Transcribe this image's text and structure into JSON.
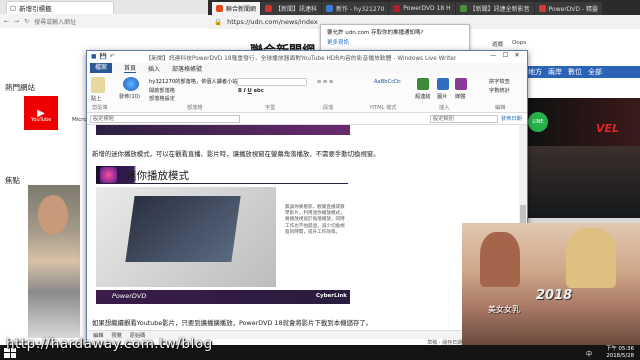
{
  "edge": {
    "tab_title": "新增引標籤",
    "search_placeholder": "搜尋或輸入網址",
    "hot_sites_title": "熱門網站",
    "youtube_label": "YouTube",
    "micro_label": "Micro",
    "focus_title": "焦點"
  },
  "udn": {
    "tabs": [
      "聯合新聞網",
      "【新聞】訊連科",
      "新作 - hy321270",
      "PowerDVD 18 H",
      "【新聞】訊連全新影音",
      "PowerDVD - 精靈"
    ],
    "url": "https://udn.com/news/index",
    "logo": "聯合新聞網",
    "push_title": "要允許 udn.com 存取你的推播通知嗎?",
    "push_more": "更多資訊",
    "nav": [
      "地方",
      "兩岸",
      "數位",
      "全部"
    ],
    "icons": [
      "遊戲",
      "Oops",
      "",
      "",
      "",
      ""
    ],
    "line_label": "LINE",
    "marvel_label": "VEL"
  },
  "lw": {
    "title": "【新聞】訊連科技PowerDVD 18隆重發行，全球播放器面對YouTube HDR內容的影音播放軟體 - Windows Live Writer",
    "tabs": [
      "檔案",
      "首頁",
      "插入",
      "部落格帳號"
    ],
    "ribbon": {
      "paste": "貼上",
      "clipboard": "剪貼簿",
      "publish": "發佈(10)",
      "account": "hy321270的部落格，依個人讀者小站",
      "open_blog": "開啟部落格",
      "blog_setting": "部落格設定",
      "blog_group": "部落格",
      "font_group": "字型",
      "para_group": "段落",
      "html_style": "HTML 樣式",
      "style_sample": "AaBbCcDc",
      "hyperlink": "超連結",
      "picture": "圖片",
      "media": "媒體",
      "insert_group": "插入",
      "spell": "拼字檢查",
      "word_count": "字數統計",
      "edit_group": "編輯"
    },
    "title_placeholder": "設定標題",
    "category_placeholder": "設定類別",
    "publish_date": "發佈日期",
    "banner1_text": "",
    "doc_p1": "新增的迷你播放模式，可以在觀看直播、影片時，讓播放視窗在螢幕角落播放，不需要手動切換視窗。",
    "section_title": "迷你播放模式",
    "desc": "無論你要看影，觀賞直播或教學影片，利用迷你播放模式，將播放視窗於角落播放，同時工作也不怕錯過，減少切換視窗的時間，提升工作效率。",
    "banner2_text": "PowerDVD",
    "banner2_brand": "CyberLink",
    "doc_p2": "如果想繼續觀看Youtube影片，只要到擴播擴播放，PowerDVD 18就會將影片下載到本機儲存了。",
    "bottom_tabs": [
      "編輯",
      "預覽",
      "原始碼"
    ],
    "status": "草稿 - 儲存日期 2018/5/28 下午 05:20"
  },
  "overlay": {
    "year": "2018",
    "caption": "美女女乳"
  },
  "taskbar": {
    "lang": "中",
    "time": "下午 05:36",
    "date": "2018/5/28"
  },
  "watermark": "http://hardaway.com.tw/blog"
}
